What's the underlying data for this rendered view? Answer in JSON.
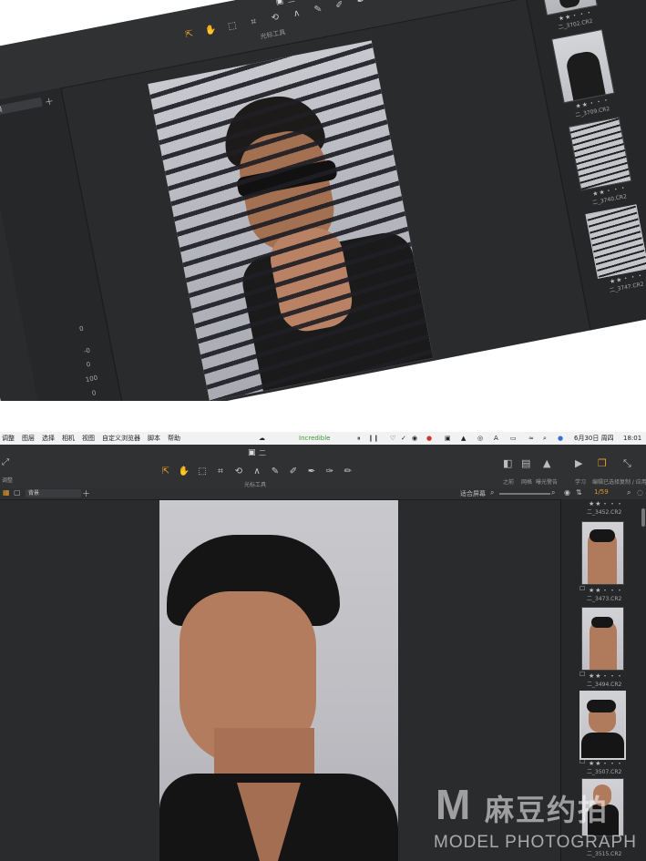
{
  "top_screenshot": {
    "doc_icon": "document-icon",
    "doc_title": "二",
    "tools_label": "光标工具",
    "layer_select": "背景",
    "panel_values": [
      "0",
      "-0",
      "0",
      "100",
      "0"
    ],
    "thumbs": [
      {
        "caption": "二_3702.CR2"
      },
      {
        "caption": "二_3709.CR2"
      },
      {
        "caption": "二_3740.CR2"
      },
      {
        "caption": "二_3747.CR2"
      }
    ],
    "stars": "★★・・・"
  },
  "menubar": {
    "items": [
      "调整",
      "图层",
      "选择",
      "相机",
      "视图",
      "自定义浏览器",
      "脚本",
      "帮助"
    ],
    "center_app": "Incredible",
    "date": "6月30日 周四",
    "time": "18:01",
    "status_icons": [
      "wechat-icon",
      "pause-icon",
      "pause-bars-icon",
      "heart-icon",
      "check-icon",
      "shield-icon",
      "record-icon",
      "camera-icon",
      "mountain-icon",
      "eye-icon",
      "a-icon",
      "battery-icon",
      "wifi-icon",
      "search-icon",
      "siri-icon",
      "control-center-icon"
    ]
  },
  "bottom_screenshot": {
    "doc_title": "二",
    "tools_label": "光标工具",
    "left_tool_label": "调整",
    "layer_select": "背景",
    "fit_label": "适合屏幕",
    "right_buttons": [
      {
        "icon": "compare-icon",
        "label": "之前"
      },
      {
        "icon": "grid-icon",
        "label": "网格"
      },
      {
        "icon": "warning-icon",
        "label": "曝光警告"
      },
      {
        "icon": "play-icon",
        "label": "学习"
      },
      {
        "icon": "copy-icon",
        "label": "编辑已选择"
      },
      {
        "icon": "copy-apply-icon",
        "label": "复制 / 应用"
      }
    ],
    "counter": "1/59",
    "thumbs": [
      {
        "caption": "二_3452.CR2"
      },
      {
        "caption": "二_3473.CR2"
      },
      {
        "caption": "二_3494.CR2"
      },
      {
        "caption": "二_3507.CR2"
      },
      {
        "caption": "二_3515.CR2"
      }
    ],
    "stars": "★★・・・"
  },
  "watermark": {
    "logo_letter": "M",
    "chinese": "麻豆约拍",
    "english": "MODEL PHOTOGRAPH"
  }
}
